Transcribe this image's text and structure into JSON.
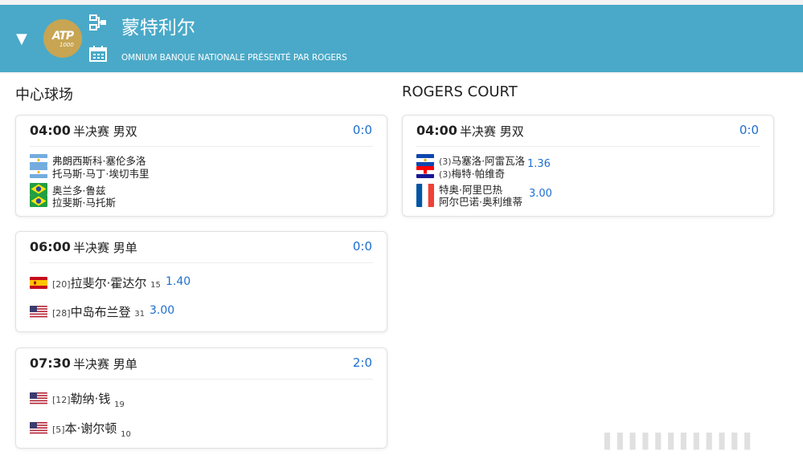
{
  "header": {
    "toggle_icon": "▼",
    "logo_text": "ATP",
    "logo_sub": "1000",
    "title": "蒙特利尔",
    "subtitle": "OMNIUM BANQUE NATIONALE PRÉSENTÉ PAR ROGERS",
    "brand_color": "#4aa9c8"
  },
  "courts": [
    {
      "name": "中心球场",
      "matches": [
        {
          "time": "04:00",
          "round": "半决赛 男双",
          "score": "0:0",
          "team1": {
            "flag": "argentina",
            "p1": "弗朗西斯科·塞伦多洛",
            "p2": "托马斯·马丁·埃切韦里"
          },
          "team2": {
            "flag": "brazil",
            "p1": "奥兰多·鲁兹",
            "p2": "拉斐斯·马托斯"
          }
        },
        {
          "time": "06:00",
          "round": "半决赛 男单",
          "score": "0:0",
          "p1": {
            "flag": "spain",
            "seed": "[20]",
            "name": "拉斐尔·霍达尔",
            "rank": "15",
            "odds": "1.40"
          },
          "p2": {
            "flag": "usa",
            "seed": "[28]",
            "name": "中岛布兰登",
            "rank": "31",
            "odds": "3.00"
          }
        },
        {
          "time": "07:30",
          "round": "半决赛 男单",
          "score": "2:0",
          "p1": {
            "flag": "usa",
            "seed": "[12]",
            "name": "勒纳·钱",
            "rank": "19"
          },
          "p2": {
            "flag": "usa",
            "seed": "[5]",
            "name": "本·谢尔顿",
            "rank": "10"
          }
        }
      ]
    },
    {
      "name": "ROGERS COURT",
      "matches": [
        {
          "time": "04:00",
          "round": "半决赛 男双",
          "score": "0:0",
          "team1": {
            "flags": [
              "el-salvador",
              "croatia"
            ],
            "seed": "(3)",
            "p1": "马塞洛·阿雷瓦洛",
            "p2": "梅特·帕维奇",
            "odds": "1.36"
          },
          "team2": {
            "flag": "france",
            "p1": "特奥·阿里巴热",
            "p2": "阿尔巴诺·奥利维蒂",
            "odds": "3.00"
          }
        }
      ]
    }
  ],
  "watermark": "▌▌▌▌▌▌▌▌▌▌▌▌"
}
